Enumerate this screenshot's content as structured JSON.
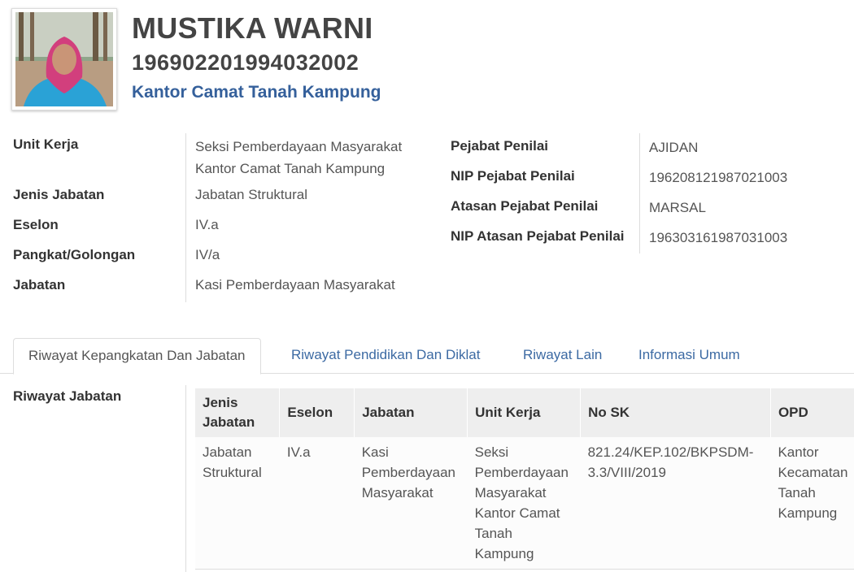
{
  "profile": {
    "name": "MUSTIKA WARNI",
    "nip": "196902201994032002",
    "office": "Kantor Camat Tanah Kampung"
  },
  "details_left": [
    {
      "label": "Unit Kerja",
      "value_line1": "Seksi Pemberdayaan Masyarakat",
      "value_line2": "Kantor Camat Tanah Kampung"
    },
    {
      "label": "Jenis Jabatan",
      "value": "Jabatan Struktural"
    },
    {
      "label": "Eselon",
      "value": "IV.a"
    },
    {
      "label": "Pangkat/Golongan",
      "value": "IV/a"
    },
    {
      "label": "Jabatan",
      "value": "Kasi Pemberdayaan Masyarakat"
    }
  ],
  "details_right": [
    {
      "label": "Pejabat Penilai",
      "value": "AJIDAN"
    },
    {
      "label": "NIP Pejabat Penilai",
      "value": "196208121987021003"
    },
    {
      "label": "Atasan Pejabat Penilai",
      "value": "MARSAL"
    },
    {
      "label": "NIP Atasan Pejabat Penilai",
      "value": "196303161987031003"
    }
  ],
  "tabs": [
    {
      "label": "Riwayat Kepangkatan Dan Jabatan",
      "active": true
    },
    {
      "label": "Riwayat Pendidikan Dan Diklat",
      "active": false
    },
    {
      "label": "Riwayat Lain",
      "active": false
    },
    {
      "label": "Informasi Umum",
      "active": false
    }
  ],
  "riwayat_jabatan": {
    "section_label": "Riwayat Jabatan",
    "headers": [
      {
        "line1": "Jenis",
        "line2": "Jabatan"
      },
      {
        "line1": "Eselon"
      },
      {
        "line1": "Jabatan"
      },
      {
        "line1": "Unit Kerja"
      },
      {
        "line1": "No SK"
      },
      {
        "line1": "OPD"
      }
    ],
    "rows": [
      {
        "jenis_jabatan": [
          "Jabatan",
          "Struktural"
        ],
        "eselon": [
          "IV.a"
        ],
        "jabatan": [
          "Kasi",
          "Pemberdayaan",
          "Masyarakat"
        ],
        "unit_kerja": [
          "Seksi",
          "Pemberdayaan",
          "Masyarakat",
          "Kantor Camat",
          "Tanah",
          "Kampung"
        ],
        "no_sk": [
          "821.24/KEP.102/BKPSDM-",
          "3.3/VIII/2019"
        ],
        "opd": [
          "Kantor",
          "Kecamatan",
          "Tanah",
          "Kampung"
        ]
      }
    ]
  },
  "colors": {
    "link": "#3c6aa3",
    "office": "#35609b",
    "table_header_bg": "#eeeeee"
  }
}
